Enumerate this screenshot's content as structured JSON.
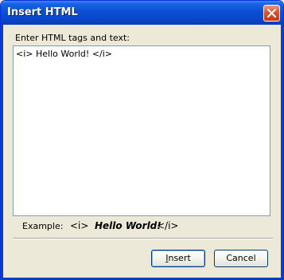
{
  "window": {
    "title": "Insert HTML",
    "close_icon": "close-icon"
  },
  "form": {
    "prompt_label": "Enter HTML tags and text:",
    "input_value": "<i> Hello World! </i>"
  },
  "example": {
    "label": "Example:",
    "open_tag": "<i>",
    "text": "Hello World!",
    "close_tag": "</i>"
  },
  "buttons": {
    "insert_label_underlined": "I",
    "insert_label_rest": "nsert",
    "cancel_label": "Cancel"
  }
}
